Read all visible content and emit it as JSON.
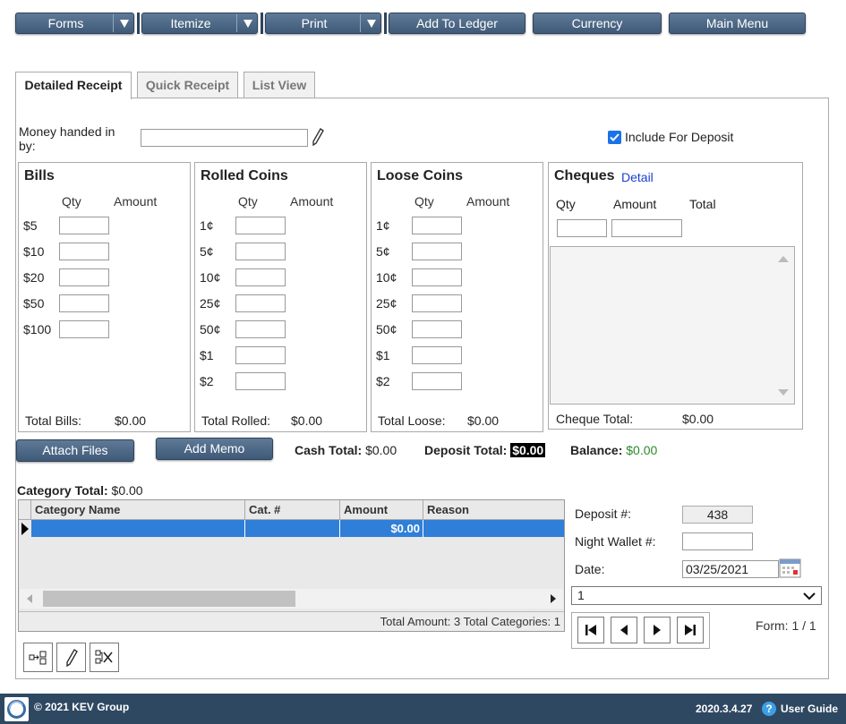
{
  "toolbar": {
    "forms": "Forms",
    "itemize": "Itemize",
    "print": "Print",
    "add_to_ledger": "Add To Ledger",
    "currency": "Currency",
    "main_menu": "Main Menu"
  },
  "tabs": {
    "detailed": "Detailed Receipt",
    "quick": "Quick Receipt",
    "list": "List View"
  },
  "form": {
    "money_handed_label": "Money handed in by:",
    "money_handed_value": "",
    "include_deposit_label": "Include For Deposit",
    "include_deposit_checked": true
  },
  "bills": {
    "title": "Bills",
    "qty": "Qty",
    "amount": "Amount",
    "rows": [
      "$5",
      "$10",
      "$20",
      "$50",
      "$100"
    ],
    "total_label": "Total Bills:",
    "total_value": "$0.00"
  },
  "rolled": {
    "title": "Rolled Coins",
    "qty": "Qty",
    "amount": "Amount",
    "rows": [
      "1¢",
      "5¢",
      "10¢",
      "25¢",
      "50¢",
      "$1",
      "$2"
    ],
    "total_label": "Total Rolled:",
    "total_value": "$0.00"
  },
  "loose": {
    "title": "Loose Coins",
    "qty": "Qty",
    "amount": "Amount",
    "rows": [
      "1¢",
      "5¢",
      "10¢",
      "25¢",
      "50¢",
      "$1",
      "$2"
    ],
    "total_label": "Total Loose:",
    "total_value": "$0.00"
  },
  "cheques": {
    "title": "Cheques",
    "detail_link": "Detail",
    "qty": "Qty",
    "amount": "Amount",
    "total": "Total",
    "total_label": "Cheque Total:",
    "total_value": "$0.00"
  },
  "actions": {
    "attach_files": "Attach Files",
    "add_memo": "Add Memo"
  },
  "summary": {
    "cash_total_label": "Cash Total:",
    "cash_total_value": "$0.00",
    "deposit_total_label": "Deposit Total:",
    "deposit_total_value": "$0.00",
    "balance_label": "Balance:",
    "balance_value": "$0.00",
    "category_total_label": "Category Total:",
    "category_total_value": "$0.00"
  },
  "grid": {
    "columns": [
      "Category Name",
      "Cat. #",
      "Amount",
      "Reason"
    ],
    "rows": [
      {
        "category_name": "",
        "cat_no": "",
        "amount": "$0.00",
        "reason": ""
      }
    ],
    "footer": "Total Amount: 3 Total Categories: 1"
  },
  "deposit": {
    "deposit_no_label": "Deposit #:",
    "deposit_no_value": "438",
    "night_wallet_label": "Night Wallet #:",
    "night_wallet_value": "",
    "date_label": "Date:",
    "date_value": "03/25/2021",
    "select_value": "1",
    "form_label": "Form: 1 / 1"
  },
  "footer": {
    "copyright": "© 2021 KEV Group",
    "version": "2020.3.4.27",
    "user_guide": "User Guide"
  },
  "colors": {
    "toolbar": "#4a6685",
    "footer": "#2f4862",
    "selected_row": "#2f7fd9",
    "balance": "#2a8a2a",
    "link": "#1a3fd1"
  }
}
